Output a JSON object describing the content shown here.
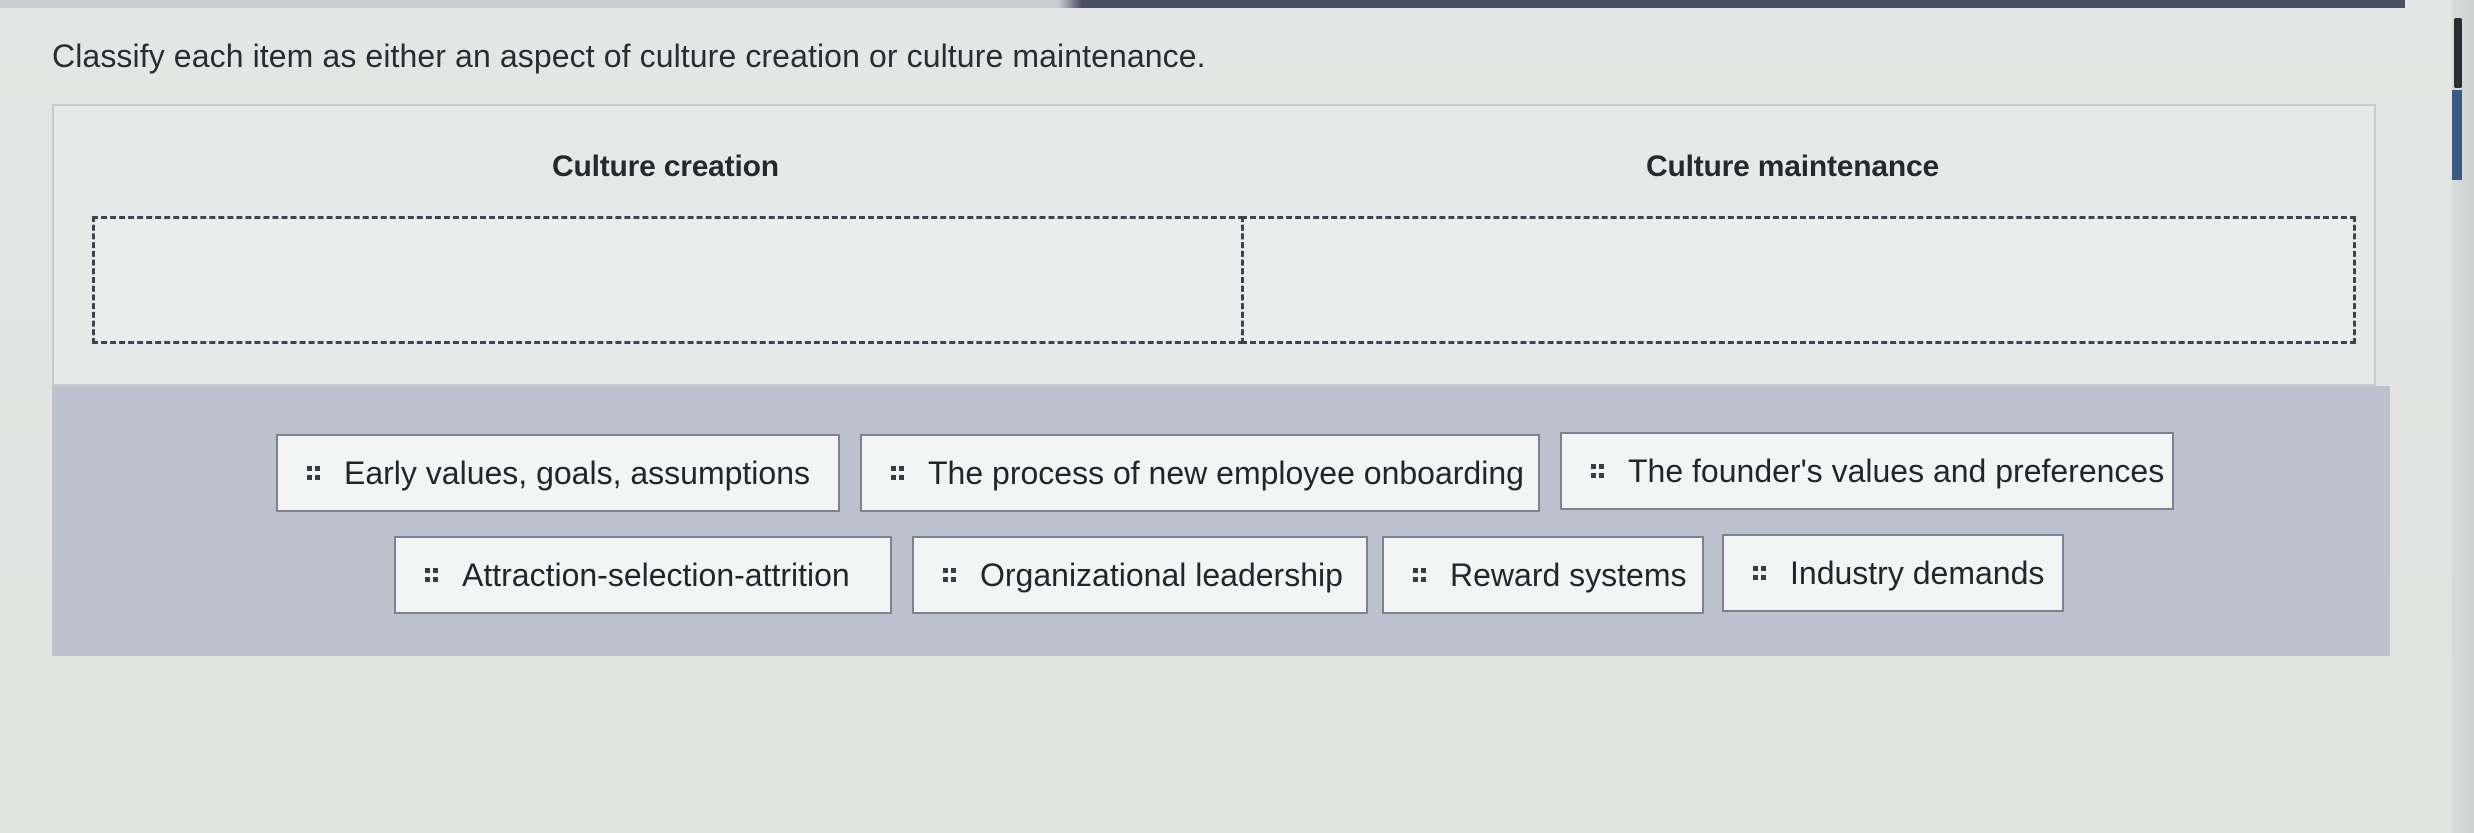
{
  "instructions": "Classify each item as either an aspect of culture creation or culture maintenance.",
  "columns": {
    "creation_label": "Culture creation",
    "maintenance_label": "Culture maintenance"
  },
  "items": [
    {
      "label": "Early values, goals, assumptions"
    },
    {
      "label": "The process of new employee onboarding"
    },
    {
      "label": "The founder's values and preferences"
    },
    {
      "label": "Attraction-selection-attrition"
    },
    {
      "label": "Organizational leadership"
    },
    {
      "label": "Reward systems"
    },
    {
      "label": "Industry demands"
    }
  ],
  "icons": {
    "chip_handle": "drag-handle-icon"
  },
  "colors": {
    "bank_background": "#bcc3ce",
    "chip_border": "#7d8290",
    "dropzone_border": "#3e4250"
  }
}
